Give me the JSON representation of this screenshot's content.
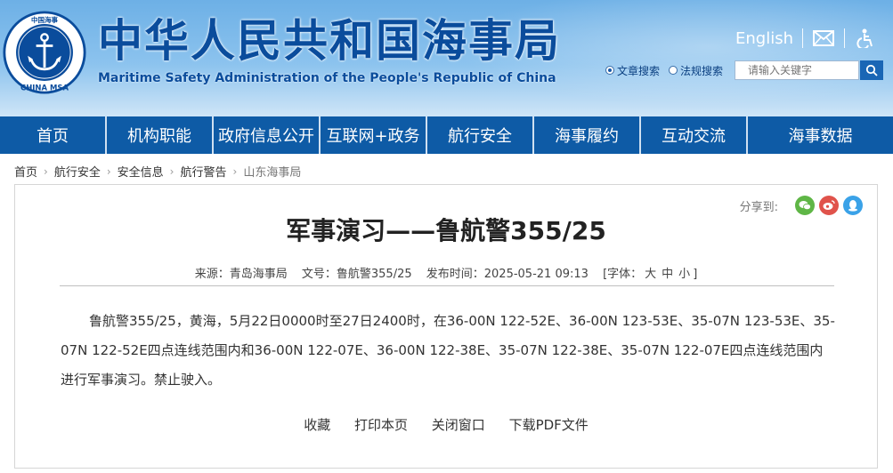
{
  "header": {
    "emblem_text_top": "中国海事",
    "emblem_text_bottom": "CHINA MSA",
    "title_cn": "中华人民共和国海事局",
    "title_en": "Maritime Safety Administration of the People's Republic of China",
    "english_link": "English",
    "search": {
      "option_article": "文章搜索",
      "option_regulation": "法规搜索",
      "placeholder": "请输入关键字"
    }
  },
  "nav": {
    "items": [
      {
        "label": "首页"
      },
      {
        "label": "机构职能"
      },
      {
        "label": "政府信息公开"
      },
      {
        "label": "互联网+政务"
      },
      {
        "label": "航行安全"
      },
      {
        "label": "海事履约"
      },
      {
        "label": "互动交流"
      },
      {
        "label": "海事数据"
      }
    ]
  },
  "breadcrumb": {
    "items": [
      {
        "label": "首页"
      },
      {
        "label": "航行安全"
      },
      {
        "label": "安全信息"
      },
      {
        "label": "航行警告"
      },
      {
        "label": "山东海事局"
      }
    ]
  },
  "article": {
    "share_label": "分享到:",
    "title": "军事演习——鲁航警355/25",
    "source": "来源：青岛海事局",
    "doc_no": "文号：鲁航警355/25",
    "published": "发布时间：2025-05-21 09:13",
    "font_label": "[字体：",
    "font_large": "大",
    "font_medium": "中",
    "font_small": "小",
    "font_close": "]",
    "body": "鲁航警355/25，黄海，5月22日0000时至27日2400时，在36-00N 122-52E、36-00N 123-53E、35-07N 123-53E、35-07N 122-52E四点连线范围内和36-00N 122-07E、36-00N 122-38E、35-07N 122-38E、35-07N 122-07E四点连线范围内进行军事演习。禁止驶入。",
    "actions": {
      "favorite": "收藏",
      "print": "打印本页",
      "close": "关闭窗口",
      "download": "下载PDF文件"
    }
  },
  "colors": {
    "brand_blue": "#0e5ba6",
    "title_blue": "#0a4c9c",
    "wechat": "#5fb646",
    "weibo": "#e0534b",
    "qq": "#3aa2e8"
  }
}
